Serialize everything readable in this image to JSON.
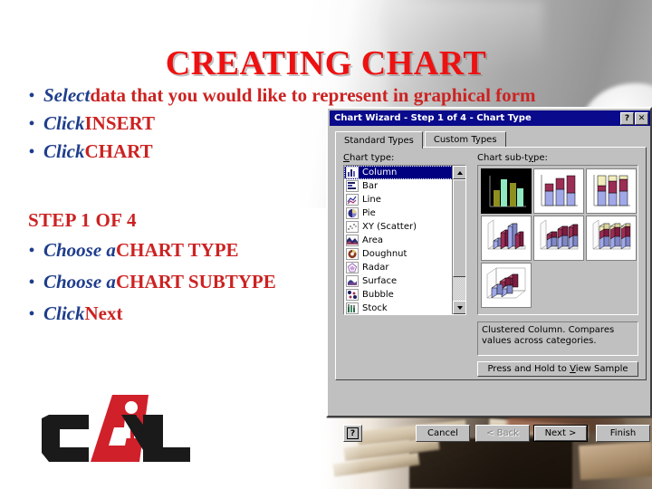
{
  "slide": {
    "title": "CREATING CHART",
    "bullets_top": [
      {
        "italic": "Select",
        "rest": " data that you would like to represent in graphical form"
      },
      {
        "italic": "Click",
        "rest": " INSERT"
      },
      {
        "italic": "Click",
        "rest": "  CHART"
      }
    ],
    "step_heading": "STEP 1 OF 4",
    "bullets_bottom": [
      {
        "italic": "Choose a",
        "rest": " CHART TYPE"
      },
      {
        "italic": "Choose a",
        "rest": " CHART SUBTYPE"
      },
      {
        "italic": "Click",
        "rest": "  Next"
      }
    ],
    "bullet_glyph": "•",
    "colors": {
      "title_red": "#EE1111",
      "bullet_blue": "#1F3D8C",
      "text_red": "#CC2222"
    },
    "logo": {
      "text": "CAL",
      "alt": "CAL logo"
    }
  },
  "dialog": {
    "title": "Chart Wizard - Step 1 of 4 - Chart Type",
    "titlebar_buttons": [
      {
        "name": "help-titlebar-button",
        "glyph": "?"
      },
      {
        "name": "close-titlebar-button",
        "glyph": "✕"
      }
    ],
    "tabs": [
      {
        "label": "Standard Types",
        "active": true
      },
      {
        "label": "Custom Types",
        "active": false
      }
    ],
    "chart_type_label": "Chart type:",
    "chart_subtype_label": "Chart sub-type:",
    "chart_types": [
      {
        "label": "Column",
        "selected": true
      },
      {
        "label": "Bar",
        "selected": false
      },
      {
        "label": "Line",
        "selected": false
      },
      {
        "label": "Pie",
        "selected": false
      },
      {
        "label": "XY (Scatter)",
        "selected": false
      },
      {
        "label": "Area",
        "selected": false
      },
      {
        "label": "Doughnut",
        "selected": false
      },
      {
        "label": "Radar",
        "selected": false
      },
      {
        "label": "Surface",
        "selected": false
      },
      {
        "label": "Bubble",
        "selected": false
      },
      {
        "label": "Stock",
        "selected": false
      }
    ],
    "subtypes": [
      {
        "name": "clustered-column",
        "selected": true
      },
      {
        "name": "stacked-column",
        "selected": false
      },
      {
        "name": "100-percent-stacked-column",
        "selected": false
      },
      {
        "name": "clustered-column-3d",
        "selected": false
      },
      {
        "name": "stacked-column-3d",
        "selected": false
      },
      {
        "name": "100-percent-stacked-column-3d",
        "selected": false
      },
      {
        "name": "3d-column",
        "selected": false
      }
    ],
    "description": "Clustered Column. Compares values across categories.",
    "sample_button": "Press and Hold to View Sample",
    "buttons": [
      {
        "name": "help-button",
        "label": "?",
        "state": "enabled"
      },
      {
        "name": "cancel-button",
        "label": "Cancel",
        "state": "enabled"
      },
      {
        "name": "back-button",
        "label": "< Back",
        "state": "disabled"
      },
      {
        "name": "next-button",
        "label": "Next >",
        "state": "default"
      },
      {
        "name": "finish-button",
        "label": "Finish",
        "state": "enabled"
      }
    ]
  }
}
